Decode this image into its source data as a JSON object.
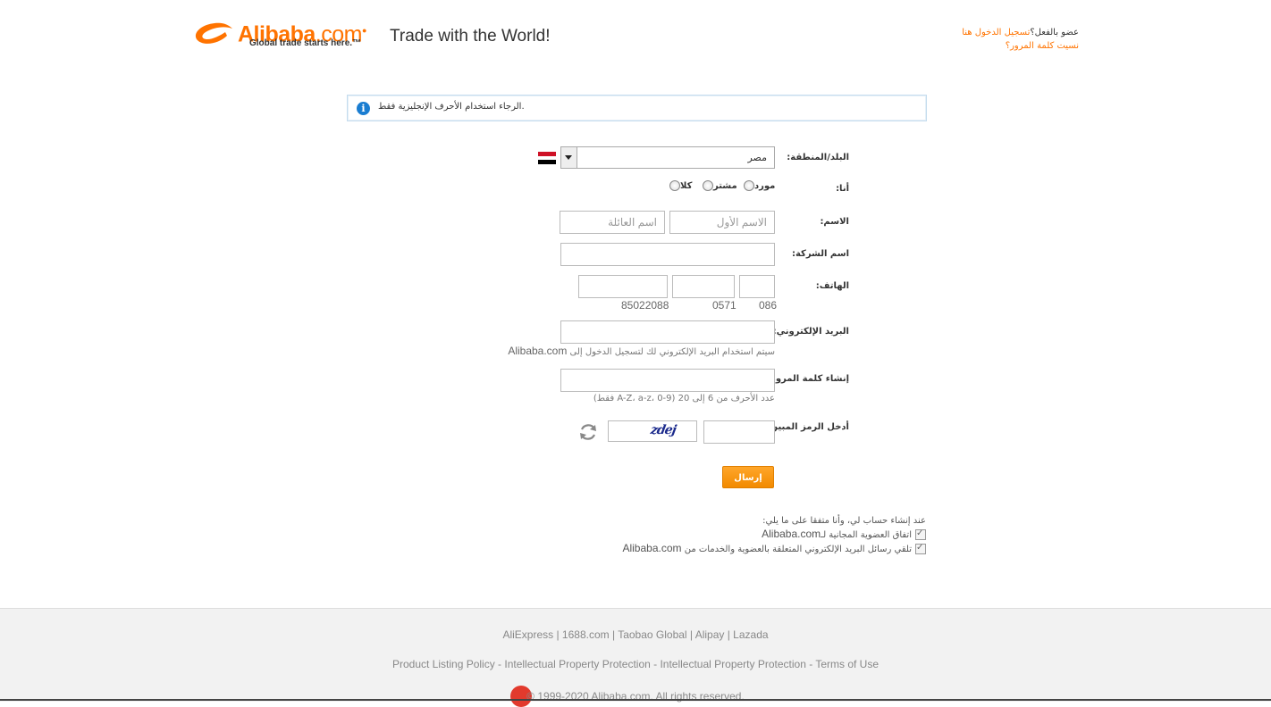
{
  "header": {
    "logo_text": "Alibaba",
    "logo_dotcom": ".com",
    "logo_tagline": "Global trade starts here.™",
    "tagline": "Trade with the World!",
    "member_question": "عضو بالفعل؟",
    "login_link": "تسجيل الدخول هنا",
    "forgot_password": "نسيت كلمة المرور؟"
  },
  "notice": {
    "message": "الرجاء استخدام الأحرف الإنجليزية فقط."
  },
  "form": {
    "country_label": "البلد/المنطقة:",
    "country_value": "مصر",
    "iam_label": "أنا:",
    "roles": [
      "مورد",
      "مشتر",
      "كلا"
    ],
    "name_label": "الاسم:",
    "first_name_placeholder": "الاسم الأول",
    "last_name_placeholder": "اسم العائلة",
    "company_label": "اسم الشركة:",
    "phone_label": "الهاتف:",
    "phone_country_hint": "086",
    "phone_area_hint": "0571",
    "phone_number_hint": "85022088",
    "email_label": "البريد الإلكتروني:",
    "email_hint": "سيتم استخدام البريد الإلكتروني لك لتسجيل الدخول إلى",
    "email_hint_site": "Alibaba.com",
    "password_label": "إنشاء كلمة المرور:",
    "password_hint": "عدد الأحرف من 6 إلى 20 (A-Z، a-z، 0-9 فقط)",
    "captcha_label": "أدخل الرمز المبين:",
    "captcha_text": "zdej",
    "submit_label": "إرسال"
  },
  "terms": {
    "intro": "عند إنشاء حساب لي، وأنا متفقا على ما يلي:",
    "item1": "اتفاق العضوية المجانية لـ",
    "item1_site": "Alibaba.com",
    "item2": "تلقي رسائل البريد الإلكتروني المتعلقة بالعضوية والخدمات من",
    "item2_site": "Alibaba.com"
  },
  "footer": {
    "links_row1": "AliExpress | 1688.com | Taobao Global | Alipay | Lazada",
    "links_row2": "Product Listing Policy - Intellectual Property Protection - Intellectual Property Protection - Terms of Use",
    "copyright": "© 1999-2020 Alibaba.com. All rights reserved."
  },
  "colors": {
    "brand_orange": "#ff7300",
    "info_blue": "#1a7dd1",
    "flag_red": "#ce1126",
    "flag_black": "#000000"
  }
}
